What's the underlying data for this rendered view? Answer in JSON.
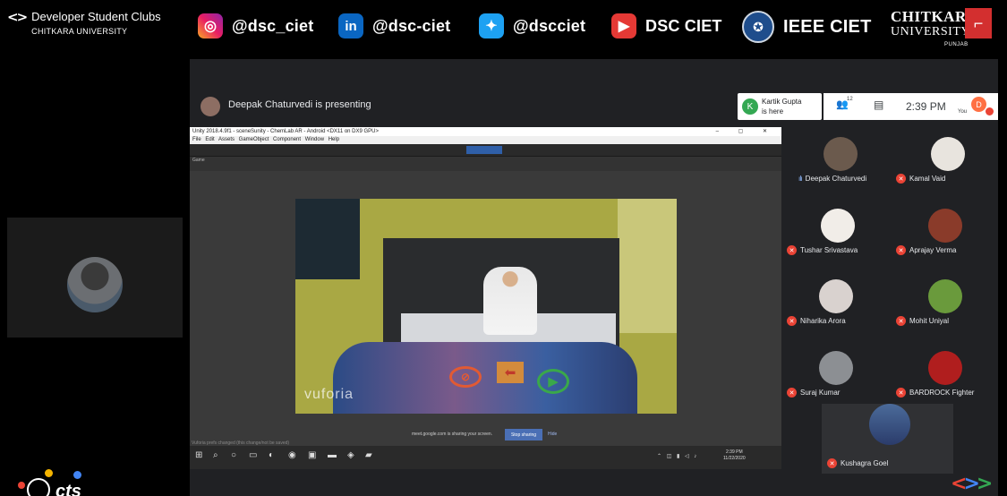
{
  "banner": {
    "club_title": "Developer Student Clubs",
    "club_subtitle": "CHITKARA UNIVERSITY",
    "instagram": "@dsc_ciet",
    "linkedin": "@dsc-ciet",
    "twitter": "@dscciet",
    "youtube": "DSC CIET",
    "ieee": "IEEE CIET",
    "chitkara_line1": "CHITKARA",
    "chitkara_line2": "UNIVERSITY",
    "chitkara_line3": "PUNJAB"
  },
  "meet": {
    "presenting_text": "Deepak Chaturvedi is presenting",
    "join_note_name": "Kartik Gupta",
    "join_note_text": "is here",
    "join_note_initial": "K",
    "participant_count": "12",
    "time": "2:39 PM",
    "you_label": "You",
    "you_initial": "D"
  },
  "screen": {
    "unity_title": "Unity 2018.4.9f1 - sceneSunity - ChemLab AR - Android <DX11 on DX9 GPU>",
    "unity_menu": "File Edit Assets GameObject Component Window Help",
    "game_tab": "Game",
    "vuforia": "vuforia",
    "share_text": "meet.google.com is sharing your screen.",
    "stop_sharing": "Stop sharing",
    "hide": "Hide",
    "status_line": "Vuforia prefs changed (this change/not be saved)",
    "clock_time": "2:39 PM",
    "clock_date": "11/22/2020",
    "clock_lang": "ENG IN"
  },
  "participants": [
    {
      "name": "Deepak Chaturvedi",
      "state": "speaking"
    },
    {
      "name": "Kamal Vaid",
      "state": "muted"
    },
    {
      "name": "Tushar Srivastava",
      "state": "muted"
    },
    {
      "name": "Aprajay Verma",
      "state": "muted"
    },
    {
      "name": "Niharika Arora",
      "state": "muted"
    },
    {
      "name": "Mohit Uniyal",
      "state": "muted"
    },
    {
      "name": "Suraj Kumar",
      "state": "muted"
    },
    {
      "name": "BARDROCK Fighter",
      "state": "muted"
    },
    {
      "name": "Kushagra Goel",
      "state": "muted"
    }
  ],
  "footer": {
    "cts_text": "cts"
  },
  "colors": {
    "meet_bg": "#202124",
    "mute_red": "#ea4335",
    "stop_sharing_blue": "#4a6fb5"
  }
}
